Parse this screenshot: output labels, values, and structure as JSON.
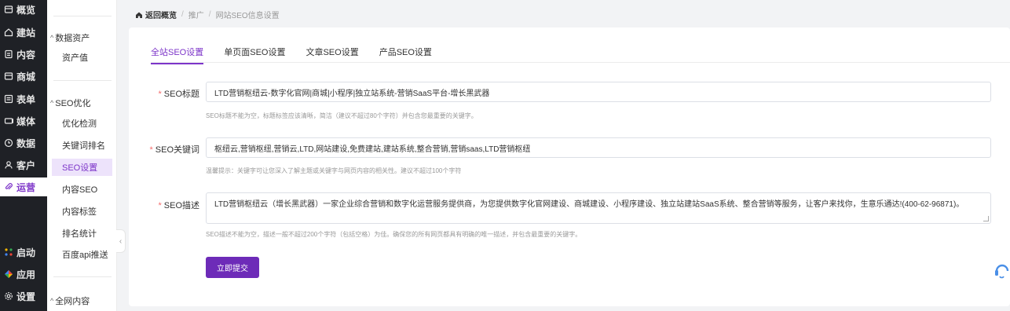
{
  "nav": {
    "items": [
      {
        "label": "概览",
        "icon": "cart-icon"
      },
      {
        "label": "建站",
        "icon": "home-icon"
      },
      {
        "label": "内容",
        "icon": "document-icon"
      },
      {
        "label": "商城",
        "icon": "shop-icon"
      },
      {
        "label": "表单",
        "icon": "form-icon"
      },
      {
        "label": "媒体",
        "icon": "media-icon"
      },
      {
        "label": "数据",
        "icon": "clock-icon"
      },
      {
        "label": "客户",
        "icon": "user-icon"
      },
      {
        "label": "运营",
        "icon": "paperclip-icon",
        "active": true
      }
    ],
    "bottom": [
      {
        "label": "启动",
        "icon": "launch-icon"
      },
      {
        "label": "应用",
        "icon": "apps-icon"
      },
      {
        "label": "设置",
        "icon": "gear-icon"
      }
    ],
    "accent": "#7d35c9",
    "background": "#1f2126"
  },
  "submenu": {
    "group1": "数据资产",
    "g1_items": [
      "资产值"
    ],
    "group2": "SEO优化",
    "g2_items": [
      "优化检测",
      "关键词排名",
      "SEO设置",
      "内容SEO",
      "内容标签",
      "排名统计",
      "百度api推送"
    ],
    "group3": "全网内容"
  },
  "breadcrumb": {
    "home": "返回概览",
    "items": [
      "推广",
      "网站SEO信息设置"
    ]
  },
  "tabs": [
    "全站SEO设置",
    "单页面SEO设置",
    "文章SEO设置",
    "产品SEO设置"
  ],
  "form": {
    "title_label": "SEO标题",
    "title_value": "LTD营销枢纽云-数字化官网|商城|小程序|独立站系统-营销SaaS平台-增长黑武器",
    "title_hint": "SEO标题不能为空，标题标签应该清晰，简洁（建议不超过80个字符）并包含您最重要的关键字。",
    "keywords_label": "SEO关键词",
    "keywords_value": "枢纽云,营销枢纽,营销云,LTD,网站建设,免费建站,建站系统,整合营销,营销saas,LTD营销枢纽",
    "keywords_hint": "温馨提示：关键字可让您深入了解主题或关键字与网页内容的相关性。建议不超过100个字符",
    "desc_label": "SEO描述",
    "desc_value": "LTD营销枢纽云（增长黑武器）一家企业综合营销和数字化运营服务提供商，为您提供数字化官网建设、商城建设、小程序建设、独立站建站SaaS系统、整合营销等服务，让客户来找你，生意乐通达!(400-62-96871)。",
    "desc_hint": "SEO描述不能为空，描述一般不超过200个字符（包括空格）为佳。确保您的所有网页都具有明确的唯一描述，并包含最重要的关键字。",
    "required_mark": "*",
    "submit_label": "立即提交"
  }
}
